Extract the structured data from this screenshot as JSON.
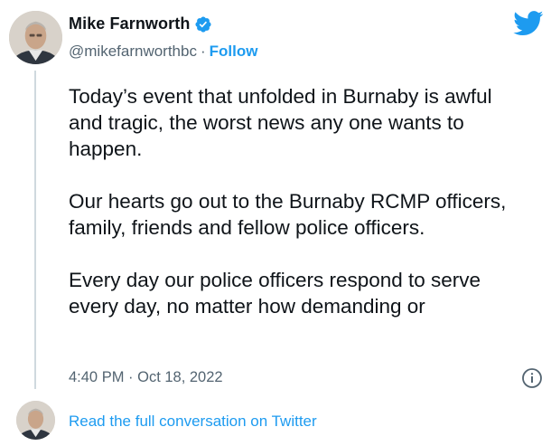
{
  "author": {
    "display_name": "Mike Farnworth",
    "handle": "@mikefarnworthbc",
    "separator": "·",
    "follow_label": "Follow"
  },
  "tweet": {
    "paragraphs": [
      "Today’s event that unfolded in Burnaby is awful and tragic, the worst news any one wants to happen.",
      "Our hearts go out to the Burnaby RCMP officers, family, friends and fellow police officers.",
      "Every day our police officers respond to serve every day, no matter how demanding or"
    ],
    "timestamp": "4:40 PM · Oct 18, 2022"
  },
  "footer": {
    "read_more_label": "Read the full conversation on Twitter"
  },
  "icons": {
    "brand": "twitter-bird-icon",
    "verified": "verified-badge-icon",
    "info": "info-icon"
  },
  "colors": {
    "accent": "#1d9bf0",
    "text": "#0f1419",
    "secondary": "#536471",
    "divider": "#cfd9de"
  }
}
